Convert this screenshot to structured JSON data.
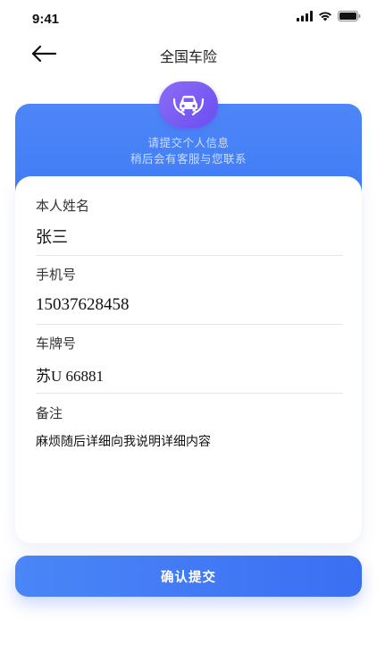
{
  "status_bar": {
    "time": "9:41"
  },
  "nav": {
    "title": "全国车险"
  },
  "header": {
    "line1": "请提交个人信息",
    "line2": "稍后会有客服与您联系",
    "badge_icon": "car-icon"
  },
  "form": {
    "name_label": "本人姓名",
    "name_value": "张三",
    "phone_label": "手机号",
    "phone_value": "15037628458",
    "plate_label": "车牌号",
    "plate_value": "苏U 66881",
    "note_label": "备注",
    "note_value": "麻烦随后详细向我说明详细内容"
  },
  "submit": {
    "label": "确认提交"
  },
  "colors": {
    "primary": "#3e7af6",
    "badge": "#7c5cf3"
  }
}
